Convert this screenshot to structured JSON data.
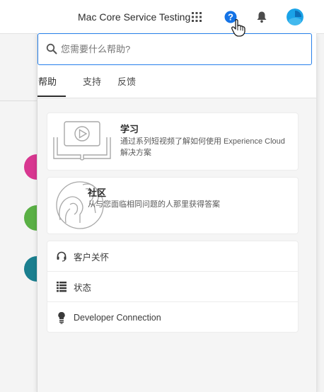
{
  "topbar": {
    "org_name": "Mac Core Service Testing",
    "icons": [
      "apps-grid-icon",
      "help-icon",
      "bell-icon",
      "avatar"
    ],
    "help_glyph": "?"
  },
  "search": {
    "placeholder": "您需要什么帮助?"
  },
  "tabs": [
    {
      "label": "帮助",
      "active": true
    },
    {
      "label": "支持",
      "active": false
    },
    {
      "label": "反馈",
      "active": false
    }
  ],
  "cards": {
    "learn": {
      "title": "学习",
      "description_line1": "通过系列短视频了解如何使用 Experience Cloud",
      "description_line2": "解决方案",
      "icon": "video-book-icon"
    },
    "community": {
      "title": "社区",
      "description": "从与您面临相同问题的人那里获得答案",
      "icon": "people-heads-icon"
    }
  },
  "links": [
    {
      "label": "客户关怀",
      "icon": "headset-icon"
    },
    {
      "label": "状态",
      "icon": "status-list-icon"
    },
    {
      "label": "Developer Connection",
      "icon": "bulb-icon"
    }
  ],
  "colors": {
    "accent": "#2680eb",
    "help_blue": "#1473e6",
    "bubble_pink": "#d83790",
    "bubble_green": "#5ab045",
    "bubble_teal": "#1b7f8f",
    "avatar_blue": "#1aa3e8"
  }
}
